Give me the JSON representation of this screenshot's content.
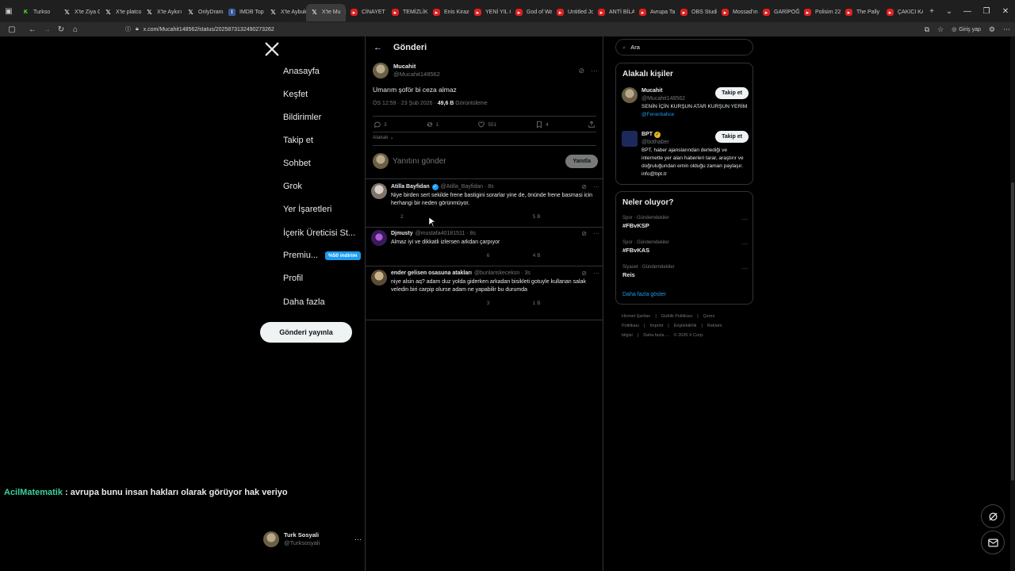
{
  "browser": {
    "tabs": [
      {
        "label": "Turkso",
        "icon": "kick-icon",
        "active": false
      },
      {
        "label": "X'te Ziya G",
        "icon": "x-icon",
        "active": false
      },
      {
        "label": "X'te platco",
        "icon": "x-icon",
        "active": false
      },
      {
        "label": "X'te Aykırı",
        "icon": "x-icon",
        "active": false
      },
      {
        "label": "OnlyDrama",
        "icon": "x-icon",
        "active": false
      },
      {
        "label": "IMDB Top",
        "icon": "imdb-icon",
        "active": false
      },
      {
        "label": "X'te Aybuk",
        "icon": "x-icon",
        "active": false
      },
      {
        "label": "X'te Mu",
        "icon": "x-icon",
        "active": true
      },
      {
        "label": "CİNAYET Ç",
        "icon": "youtube-icon",
        "active": false
      },
      {
        "label": "TEMİZLİK 3",
        "icon": "youtube-icon",
        "active": false
      },
      {
        "label": "Enis Kirazo",
        "icon": "youtube-icon",
        "active": false
      },
      {
        "label": "YENİ YIL Ç",
        "icon": "youtube-icon",
        "active": false
      },
      {
        "label": "God of Wa",
        "icon": "youtube-icon",
        "active": false
      },
      {
        "label": "Untitled Jo",
        "icon": "youtube-icon",
        "active": false
      },
      {
        "label": "ANTİ BİLAL",
        "icon": "youtube-icon",
        "active": false
      },
      {
        "label": "Avrupa Ta",
        "icon": "youtube-icon",
        "active": false
      },
      {
        "label": "OBS Studio",
        "icon": "youtube-icon",
        "active": false
      },
      {
        "label": "Mossad'ın",
        "icon": "youtube-icon",
        "active": false
      },
      {
        "label": "GARİPOĞL",
        "icon": "youtube-icon",
        "active": false
      },
      {
        "label": "Polisim 22",
        "icon": "youtube-icon",
        "active": false
      },
      {
        "label": "The Pally",
        "icon": "youtube-icon",
        "active": false
      },
      {
        "label": "ÇAKICI KA",
        "icon": "youtube-icon",
        "active": false
      }
    ],
    "url": "x.com/Mucahit148562/status/2025873132490273262",
    "profile_label": "Giriş yap"
  },
  "sidebar": {
    "items": [
      {
        "label": "Anasayfa",
        "icon": "home-icon"
      },
      {
        "label": "Keşfet",
        "icon": "search-icon"
      },
      {
        "label": "Bildirimler",
        "icon": "bell-icon"
      },
      {
        "label": "Takip et",
        "icon": "person-add-icon"
      },
      {
        "label": "Sohbet",
        "icon": "mail-icon"
      },
      {
        "label": "Grok",
        "icon": "grok-icon"
      },
      {
        "label": "Yer İşaretleri",
        "icon": "bookmark-icon"
      },
      {
        "label": "İçerik Üreticisi St...",
        "icon": "lightning-icon"
      },
      {
        "label": "Premiu...",
        "icon": "x-icon"
      },
      {
        "label": "Profil",
        "icon": "person-icon"
      },
      {
        "label": "Daha fazla",
        "icon": "more-circle-icon"
      }
    ],
    "premium_badge": "%50 indirim",
    "post_button": "Gönderi yayınla",
    "account": {
      "name": "Turk Sosyali",
      "handle": "@Turksosyali"
    }
  },
  "main": {
    "header_title": "Gönderi",
    "post": {
      "name": "Mucahit",
      "handle": "@Mucahit148562",
      "text": "Umarım şoför bi ceza almaz",
      "time": "ÖS 12:59 · 23 Şub 2026 · ",
      "views": "49,6 B",
      "views_label": " Görüntüleme",
      "replies": "3",
      "reposts": "1",
      "likes": "551",
      "bookmarks": "4"
    },
    "relevant_label": "Alakalı",
    "reply_placeholder": "Yanıtını gönder",
    "reply_button": "Yanıtla",
    "replies": [
      {
        "name": "Atilla Bayfidan",
        "handle": "@Atilla_Bayfidan · 8s",
        "text": "Niye birden sert sekilde frene bastigini sorarlar yine de, önünde frene basmasi icin herhangi bir neden görünmüyor.",
        "replies": "2",
        "reposts": "",
        "likes": "",
        "views": "5 B"
      },
      {
        "name": "Djmusty",
        "handle": "@mustafa40181511 · 8s",
        "text": "Almaz iyi ve dikkatli izlersen arkdan çarpıyor",
        "replies": "",
        "reposts": "",
        "likes": "6",
        "views": "4 B"
      },
      {
        "name": "ender gelisen osasuna atakları",
        "handle": "@bunlariskeceksn · 3s",
        "text": "niye alsin aq? adam duz yolda giderken arkadan bisikleti gotuyle kullanan salak veledin biri carpip olurse adam ne yapabilir bu durumda",
        "replies": "",
        "reposts": "",
        "likes": "3",
        "views": "1 B"
      }
    ]
  },
  "right": {
    "search_placeholder": "Ara",
    "people_title": "Alakalı kişiler",
    "people": [
      {
        "name": "Mucahit",
        "handle": "@Mucahit148562",
        "bio": "SENİN İÇİN KURŞUN ATAR KURŞUN YERİM ",
        "bio_link": "@Fenerbahce",
        "follow": "Takip et"
      },
      {
        "name": "BPT",
        "handle": "@bothaber",
        "bio": "BPT, haber ajanslarından derlediği ve internette yer alan haberleri tarar, araştırır ve doğruluğundan emin olduğu zaman paylaşır. info@bpt.tr",
        "bio_link": "",
        "follow": "Takip et"
      }
    ],
    "trends_title": "Neler oluyor?",
    "trends": [
      {
        "category": "Spor · Gündemdekiler",
        "tag": "#FBvKSP"
      },
      {
        "category": "Spor · Gündemdekiler",
        "tag": "#FBvKAS"
      },
      {
        "category": "Siyaset · Gündemdekiler",
        "tag": "Reis"
      }
    ],
    "show_more": "Daha fazla göster",
    "footer": [
      "Hizmet Şartları",
      "|",
      "Gizlilik Politikası",
      "|",
      "Çerez Politikası",
      "|",
      "Imprint",
      "|",
      "Erişilebilirlik",
      "|",
      "Reklam bilgisi",
      "|",
      "Daha fazla ...",
      "© 2026 X Corp."
    ]
  },
  "overlay": {
    "chat_user": "AcilMatematik",
    "chat_message": " : avrupa bunu insan hakları olarak görüyor hak veriyo"
  },
  "colors": {
    "accent": "#1d9bf0",
    "chat_user": "#3ad29f",
    "background": "#000000"
  }
}
